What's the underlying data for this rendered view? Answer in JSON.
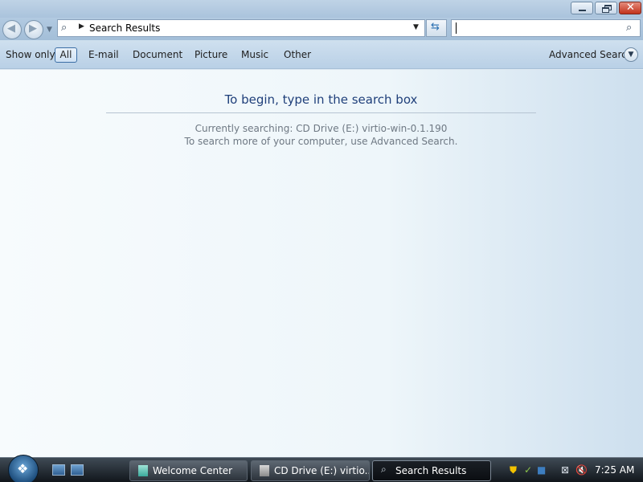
{
  "window": {
    "title": "Search Results"
  },
  "address_bar": {
    "path": "Search Results"
  },
  "search_box": {
    "value": ""
  },
  "filter_bar": {
    "show_only_label": "Show only:",
    "filters": [
      "All",
      "E-mail",
      "Document",
      "Picture",
      "Music",
      "Other"
    ],
    "selected": "All",
    "advanced_search_label": "Advanced Search"
  },
  "content": {
    "heading": "To begin, type in the search box",
    "info_line1": "Currently searching: CD Drive (E:) virtio-win-0.1.190",
    "info_line2": "To search more of your computer, use Advanced Search."
  },
  "taskbar": {
    "tasks": [
      {
        "label": "Welcome Center"
      },
      {
        "label": "CD Drive (E:) virtio..."
      },
      {
        "label": "Search Results"
      }
    ],
    "clock": "7:25 AM"
  },
  "colors": {
    "accent": "#1f3f7a",
    "close_button": "#c2321b",
    "info_text": "#6e7883"
  }
}
